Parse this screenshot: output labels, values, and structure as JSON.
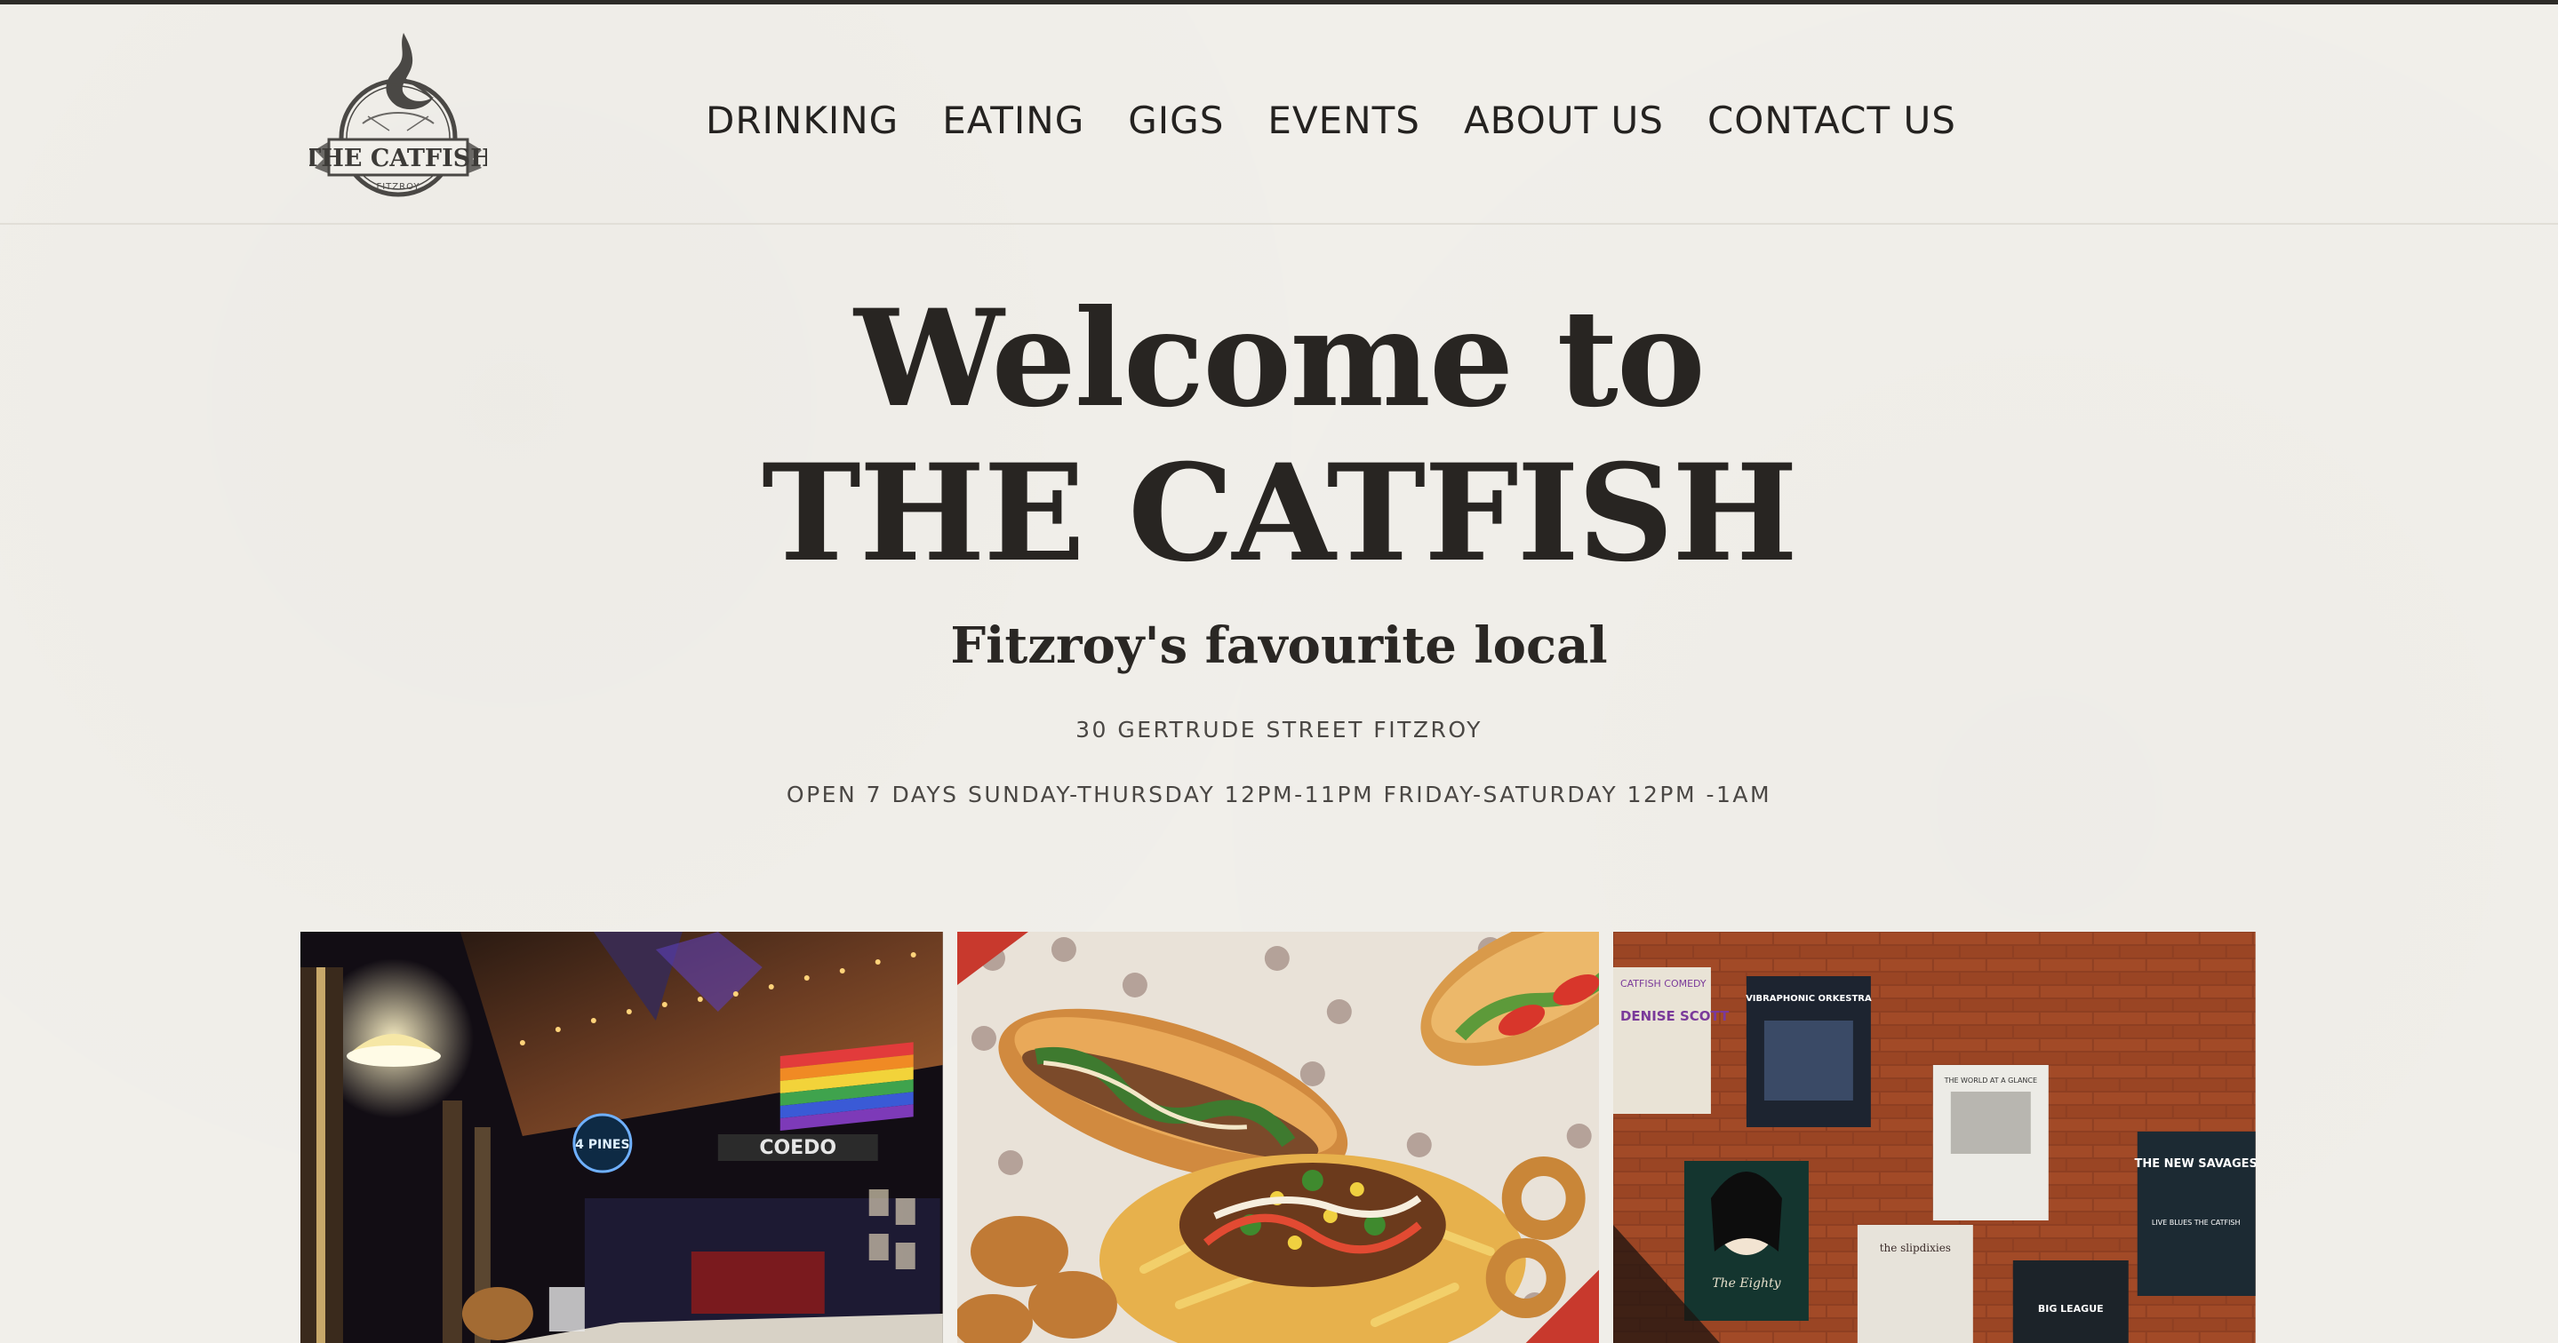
{
  "header": {
    "logo": {
      "text": "THE CATFISH",
      "subtext": "FITZROY"
    },
    "nav": [
      {
        "label": "DRINKING"
      },
      {
        "label": "EATING"
      },
      {
        "label": "GIGS"
      },
      {
        "label": "EVENTS"
      },
      {
        "label": "ABOUT US"
      },
      {
        "label": "CONTACT US"
      }
    ]
  },
  "hero": {
    "title_line1": "Welcome to",
    "title_line2": "THE CATFISH",
    "subtitle": "Fitzroy's favourite local",
    "address": "30 GERTRUDE STREET FITZROY",
    "hours": "OPEN 7 DAYS SUNDAY-THURSDAY 12PM-11PM FRIDAY-SATURDAY 12PM -1AM"
  },
  "gallery": {
    "bar_photo": {
      "signs": [
        "4 PINES",
        "COEDO"
      ]
    },
    "food_photo": {},
    "posters_photo": {
      "posters": [
        "CATFISH COMEDY",
        "DENISE SCOTT",
        "VIBRAPHONIC ORKESTRA",
        "THE WORLD AT A GLANCE",
        "THE NEW SAVAGES",
        "LIVE BLUES THE CATFISH",
        "The Eighty",
        "the slipdixies",
        "BIG LEAGUE"
      ]
    }
  },
  "colors": {
    "background": "#f1efea",
    "text": "#262422",
    "accent_rule": "#2d2b28"
  }
}
